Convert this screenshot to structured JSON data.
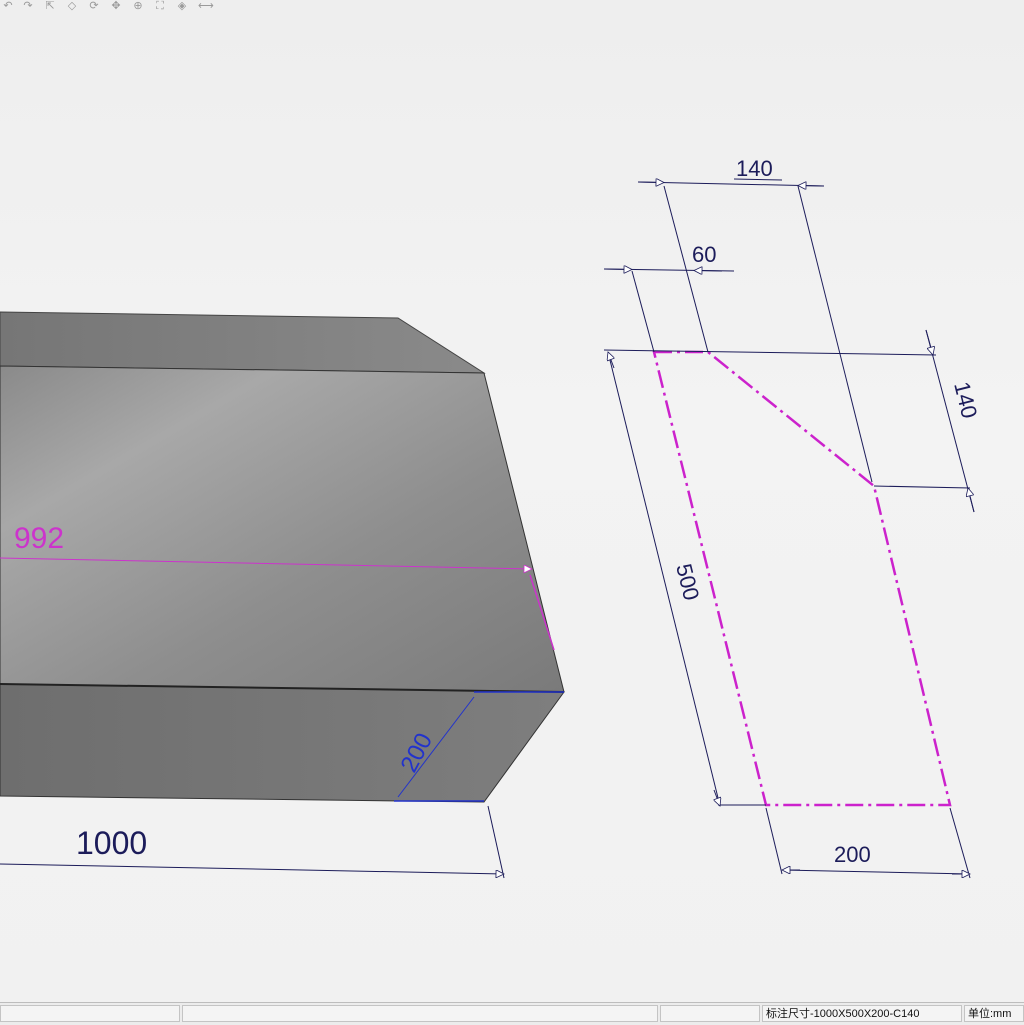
{
  "toolbar": {
    "icons": [
      "undo-icon",
      "redo-icon",
      "select-icon",
      "view-icon",
      "rotate-icon",
      "pan-icon",
      "zoom-icon",
      "fit-icon",
      "section-icon",
      "measure-icon"
    ]
  },
  "model": {
    "dims": {
      "length": "1000",
      "thickness": "200",
      "diagonal_length": "992"
    }
  },
  "profile": {
    "dims": {
      "top_width": "140",
      "chamfer_width": "60",
      "chamfer_height": "140",
      "height": "500",
      "bottom_width": "200"
    }
  },
  "status": {
    "spec": "标注尺寸-1000X500X200-C140",
    "unit": "单位:mm"
  },
  "colors": {
    "dimension": "#1c1c5a",
    "profile_line": "#cc22cc",
    "highlight_dim": "#cc33cc",
    "edge_dim": "#2233cc"
  }
}
